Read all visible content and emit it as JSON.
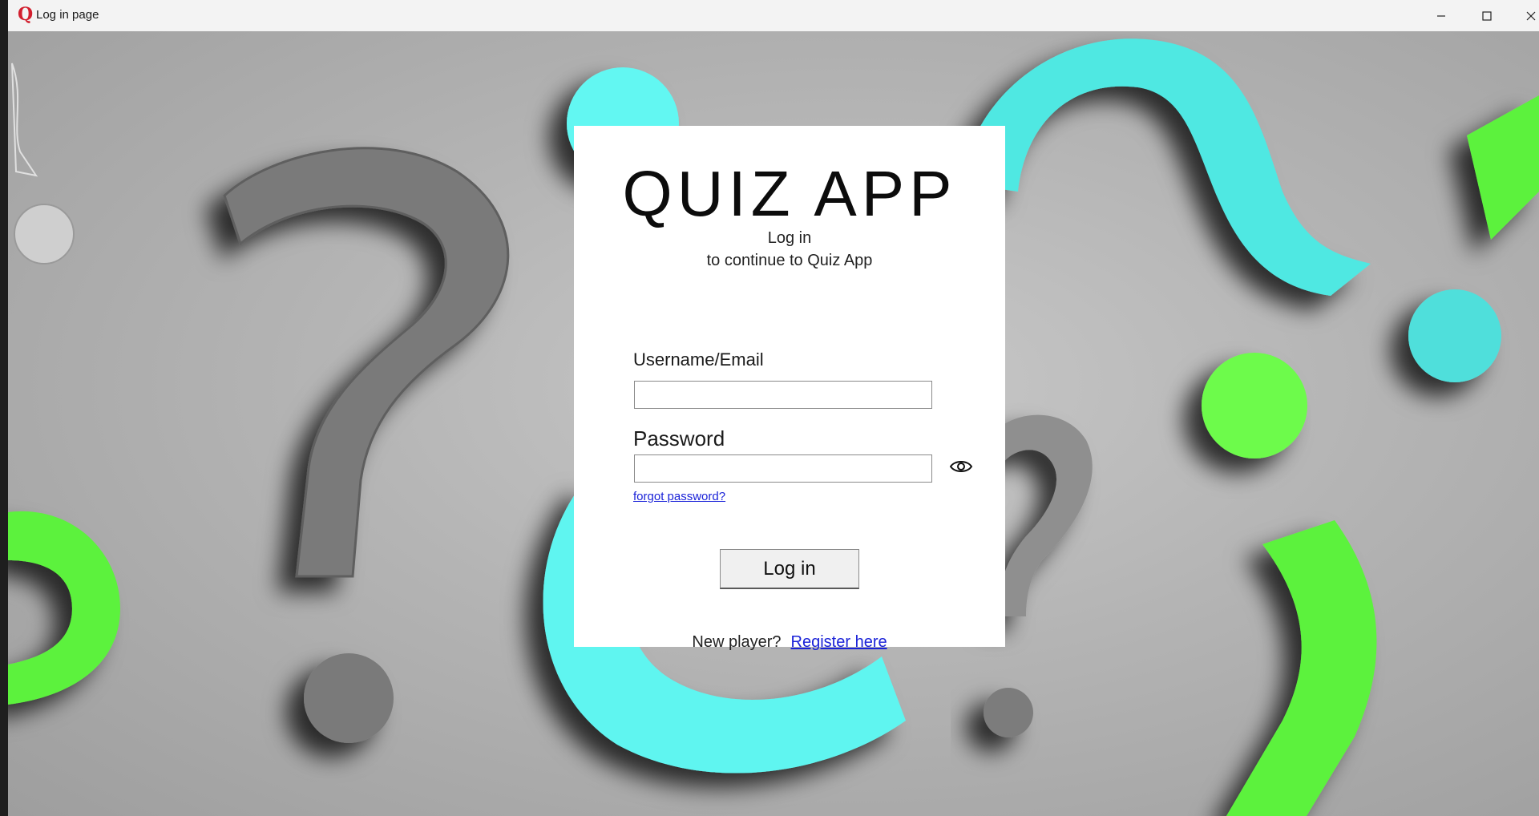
{
  "window": {
    "title": "Log in page",
    "app_icon": "Q",
    "controls": [
      "minimize-icon",
      "maximize-icon",
      "close-icon"
    ]
  },
  "login": {
    "brand": "QUIZ APP",
    "subtitle_line1": "Log in",
    "subtitle_line2": "to continue to Quiz App",
    "username_label": "Username/Email",
    "username_value": "",
    "password_label": "Password",
    "password_value": "",
    "show_password_icon": "eye-icon",
    "forgot_password": "forgot password?",
    "login_button": "Log in",
    "new_player_text": "New player?",
    "register_link": "Register here"
  },
  "colors": {
    "background_gray": "#b4b4b4",
    "accent_cyan": "#5ff5f0",
    "accent_green": "#5cf23c",
    "link_blue": "#1a22d8",
    "app_icon_red": "#d21f2e"
  }
}
